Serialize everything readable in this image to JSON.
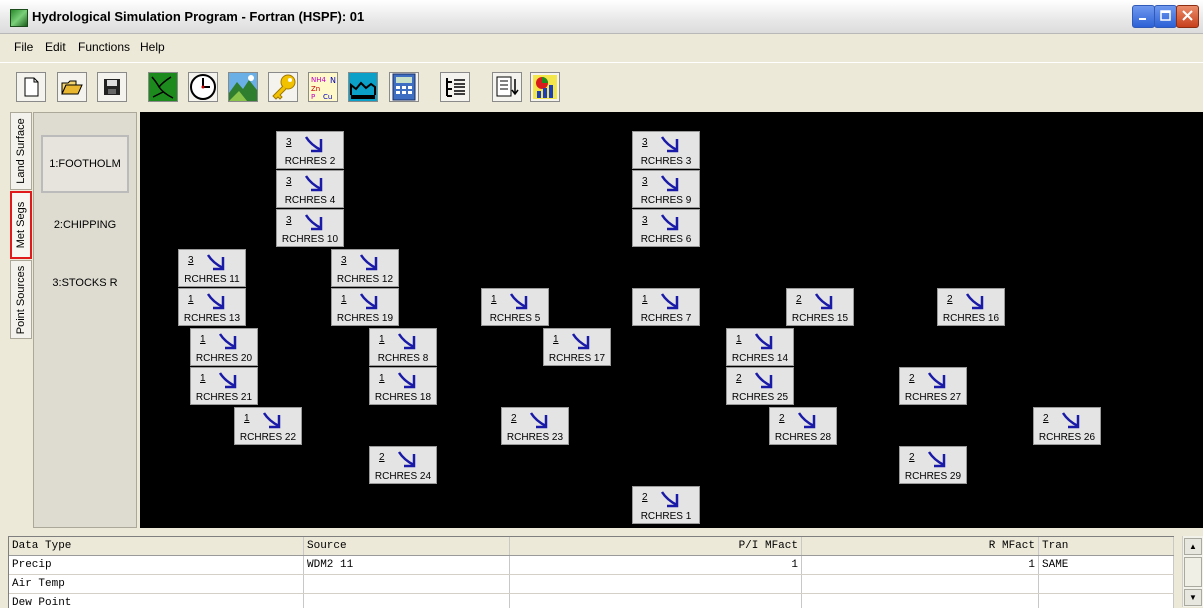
{
  "window": {
    "title": "Hydrological Simulation Program - Fortran (HSPF): 01"
  },
  "menu": [
    "File",
    "Edit",
    "Functions",
    "Help"
  ],
  "toolbar": {
    "buttons": [
      "new-document",
      "open-folder",
      "save-disk",
      "river-network",
      "clock",
      "landscape",
      "key",
      "water-quality-constituents",
      "reach-profile",
      "calculator",
      "tree-view",
      "list-output",
      "chart-output"
    ],
    "wq_labels": {
      "nh4": "NH4",
      "n": "N",
      "zn": "Zn",
      "p": "P",
      "cu": "Cu"
    }
  },
  "side_tabs": [
    "Land Surface",
    "Met Segs",
    "Point Sources"
  ],
  "active_tab": "Met Segs",
  "met_segments": [
    "1:FOOTHOLM",
    "2:CHIPPING",
    "3:STOCKS R"
  ],
  "selected_segment": "1:FOOTHOLM",
  "reaches": [
    {
      "num": "3",
      "name": "RCHRES 2"
    },
    {
      "num": "3",
      "name": "RCHRES 4"
    },
    {
      "num": "3",
      "name": "RCHRES 10"
    },
    {
      "num": "3",
      "name": "RCHRES 3"
    },
    {
      "num": "3",
      "name": "RCHRES 9"
    },
    {
      "num": "3",
      "name": "RCHRES 6"
    },
    {
      "num": "3",
      "name": "RCHRES 11"
    },
    {
      "num": "1",
      "name": "RCHRES 13"
    },
    {
      "num": "3",
      "name": "RCHRES 12"
    },
    {
      "num": "1",
      "name": "RCHRES 19"
    },
    {
      "num": "1",
      "name": "RCHRES 5"
    },
    {
      "num": "1",
      "name": "RCHRES 7"
    },
    {
      "num": "2",
      "name": "RCHRES 15"
    },
    {
      "num": "2",
      "name": "RCHRES 16"
    },
    {
      "num": "1",
      "name": "RCHRES 20"
    },
    {
      "num": "1",
      "name": "RCHRES 8"
    },
    {
      "num": "1",
      "name": "RCHRES 17"
    },
    {
      "num": "1",
      "name": "RCHRES 14"
    },
    {
      "num": "1",
      "name": "RCHRES 21"
    },
    {
      "num": "1",
      "name": "RCHRES 18"
    },
    {
      "num": "2",
      "name": "RCHRES 25"
    },
    {
      "num": "2",
      "name": "RCHRES 27"
    },
    {
      "num": "1",
      "name": "RCHRES 22"
    },
    {
      "num": "2",
      "name": "RCHRES 23"
    },
    {
      "num": "2",
      "name": "RCHRES 28"
    },
    {
      "num": "2",
      "name": "RCHRES 26"
    },
    {
      "num": "2",
      "name": "RCHRES 24"
    },
    {
      "num": "2",
      "name": "RCHRES 29"
    },
    {
      "num": "2",
      "name": "RCHRES 1"
    }
  ],
  "grid": {
    "columns": [
      "Data Type",
      "Source",
      "P/I MFact",
      "R MFact",
      "Tran"
    ],
    "rows": [
      [
        "Precip",
        "WDM2 11",
        "1",
        "1",
        "SAME"
      ],
      [
        "Air Temp",
        "",
        "",
        "",
        ""
      ],
      [
        "Dew Point",
        "",
        "",
        "",
        ""
      ]
    ]
  },
  "colors": {
    "canvas_bg": "#000000",
    "arrow": "#1a1aa8",
    "highlight": "#e01a1a"
  }
}
